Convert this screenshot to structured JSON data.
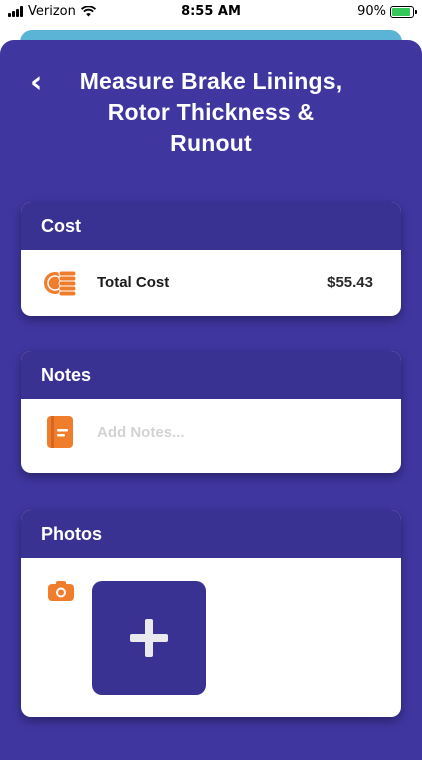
{
  "status_bar": {
    "carrier": "Verizon",
    "time": "8:55 AM",
    "battery_percent": "90%",
    "battery_level": 0.9,
    "icons": [
      "signal-icon",
      "wifi-icon",
      "battery-charging-icon"
    ]
  },
  "header": {
    "back_icon": "chevron-left-icon",
    "back_glyph": "‹",
    "title": "Measure Brake Linings, Rotor Thickness & Runout"
  },
  "cost": {
    "header": "Cost",
    "icon": "coins-icon",
    "label": "Total Cost",
    "value": "$55.43"
  },
  "notes": {
    "header": "Notes",
    "icon": "notebook-icon",
    "value": "",
    "placeholder": "Add Notes..."
  },
  "photos": {
    "header": "Photos",
    "icon": "camera-icon",
    "add_icon": "plus-icon"
  },
  "colors": {
    "background": "#3f36a0",
    "card_header": "#3a3292",
    "accent_orange": "#f07d2c",
    "battery_green": "#34c759",
    "peek_sheet": "#5bb3d6"
  }
}
